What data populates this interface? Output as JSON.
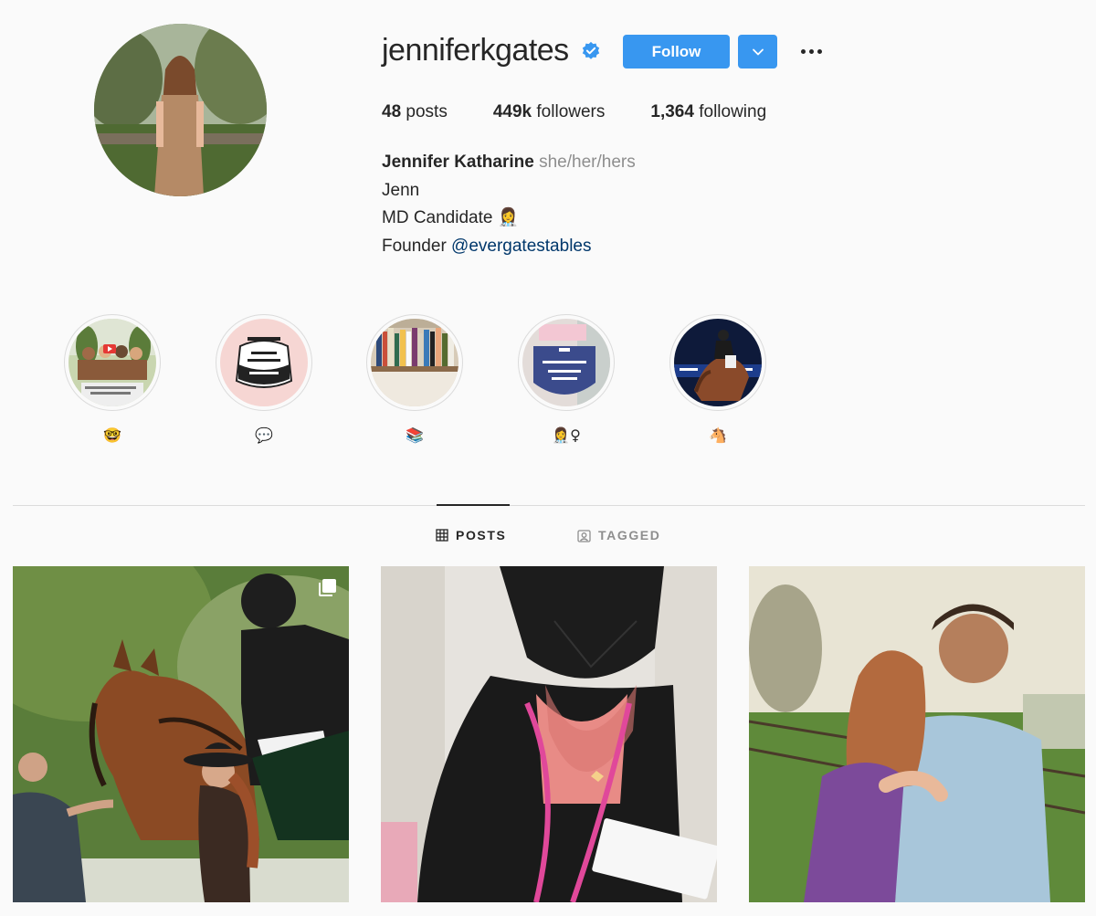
{
  "profile": {
    "username": "jenniferkgates",
    "verified": true,
    "follow_label": "Follow",
    "stats": {
      "posts_count": "48",
      "posts_label": "posts",
      "followers_count": "449k",
      "followers_label": "followers",
      "following_count": "1,364",
      "following_label": "following"
    },
    "bio": {
      "full_name": "Jennifer Katharine",
      "pronouns": "she/her/hers",
      "line1": "Jenn",
      "line2": "MD Candidate 👩‍⚕️",
      "line3_prefix": "Founder ",
      "line3_link": "@evergatestables"
    }
  },
  "highlights": [
    {
      "label": "🤓"
    },
    {
      "label": "💬"
    },
    {
      "label": "📚"
    },
    {
      "label": "👩‍⚕️♀"
    },
    {
      "label": "🐴"
    }
  ],
  "tabs": {
    "posts": "POSTS",
    "tagged": "TAGGED",
    "active": "posts"
  },
  "posts": [
    {
      "icon": "multiple-photos-icon"
    },
    {},
    {}
  ],
  "colors": {
    "accent": "#3897f0",
    "link": "#00376b",
    "muted": "#8e8e8e",
    "text": "#262626",
    "background": "#fafafa",
    "verified": "#3897f0"
  }
}
